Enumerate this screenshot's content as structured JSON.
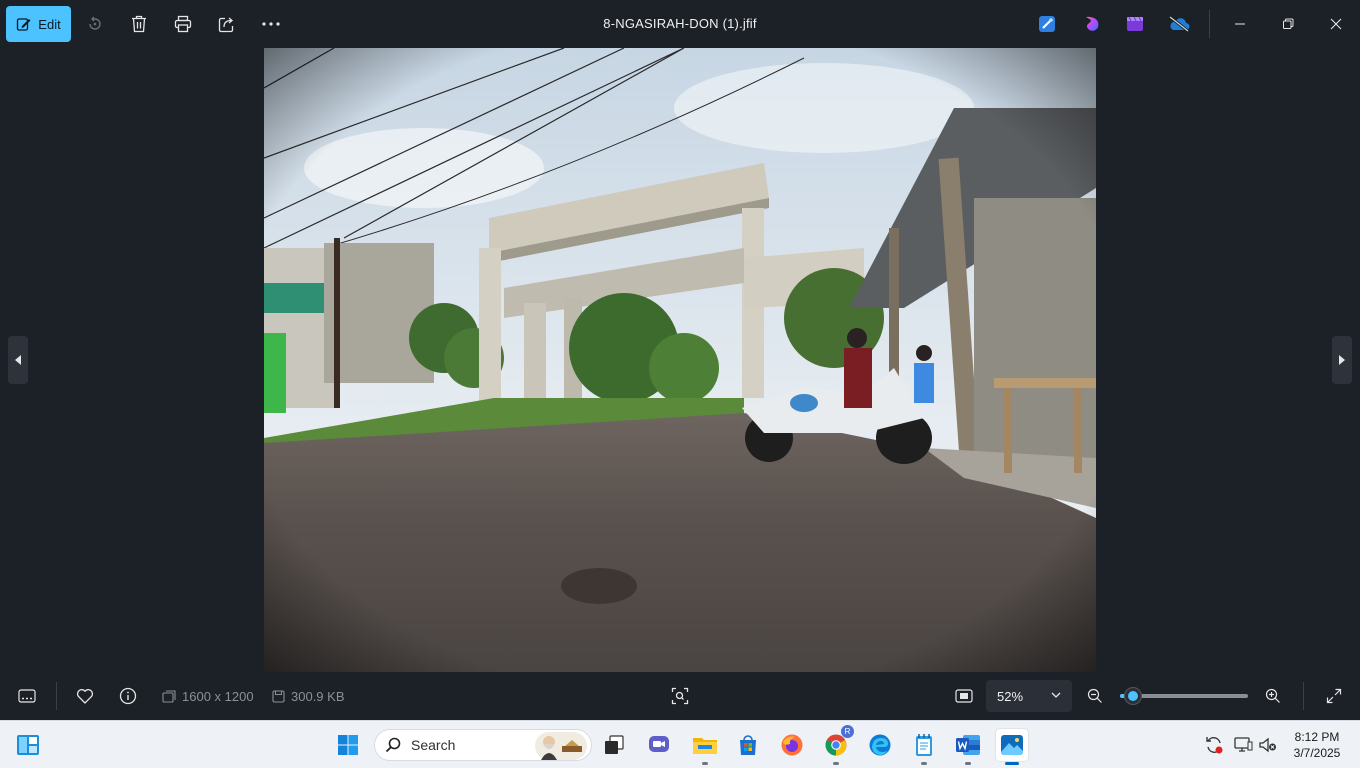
{
  "window": {
    "title": "8-NGASIRAH-DON   (1).jfif",
    "edit_label": "Edit"
  },
  "toolbar_icons": [
    "edit-icon",
    "rotate-icon",
    "delete-icon",
    "print-icon",
    "share-icon",
    "more-icon"
  ],
  "header_apps": [
    "designer-icon",
    "clipchamp-bloom-icon",
    "clipchamp-icon",
    "onedrive-icon"
  ],
  "info": {
    "dimensions": "1600 x 1200",
    "filesize": "300.9 KB"
  },
  "zoom": {
    "value_label": "52%",
    "slider_fraction": 0.1
  },
  "taskbar": {
    "search_placeholder": "Search",
    "time": "8:12 PM",
    "date": "3/7/2025",
    "chrome_badge": "R"
  },
  "colors": {
    "accent": "#4cc2ff",
    "app_bg": "#1c2027",
    "taskbar_bg": "#eef1f6"
  }
}
